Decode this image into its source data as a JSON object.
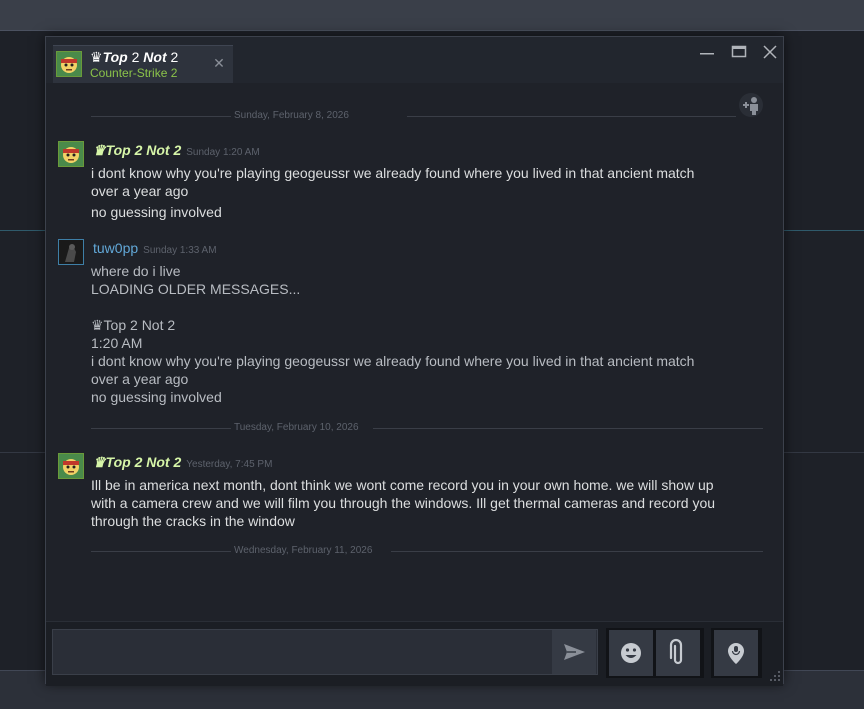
{
  "tab": {
    "name_prefix": "♛",
    "name_bold1": "Top",
    "name_mid": " 2 ",
    "name_bold2": "Not",
    "name_end": " 2",
    "game": "Counter-Strike 2",
    "close": "✕"
  },
  "dividers": [
    {
      "label": "Sunday, February 8, 2026"
    },
    {
      "label": "Tuesday, February 10, 2026"
    },
    {
      "label": "Wednesday, February 11, 2026"
    }
  ],
  "messages": [
    {
      "sender": "♛Top 2 Not 2",
      "timestamp": "Sunday 1:20 AM",
      "lines": [
        "i dont know why you're playing geogeussr we already found where you lived in that ancient match",
        "over a year ago",
        "no guessing involved"
      ]
    },
    {
      "sender": "tuw0pp",
      "timestamp": "Sunday 1:33 AM",
      "lines": [
        "where do i live",
        "LOADING OLDER MESSAGES...",
        "",
        "♛Top 2 Not 2",
        "1:20 AM",
        "i dont know why you're playing geogeussr we already found where you lived in that ancient match",
        "over a year ago",
        "no guessing involved"
      ]
    },
    {
      "sender": "♛Top 2 Not 2",
      "timestamp": "Yesterday, 7:45 PM",
      "lines": [
        "Ill be in america next month, dont think we wont come record you in your own home. we will show up",
        "with a camera crew and we will film you through the windows. Ill get thermal cameras and record you",
        "through the cracks in the window"
      ]
    }
  ],
  "composer": {
    "placeholder": "",
    "send_icon": "send-icon",
    "emoji_icon": "emoticon-icon",
    "attach_icon": "paperclip-icon",
    "voice_icon": "voice-pin-icon"
  },
  "colors": {
    "accent_green": "#8bc34a",
    "sender_green": "#d6f5a8",
    "sender_blue": "#62a8d8"
  }
}
